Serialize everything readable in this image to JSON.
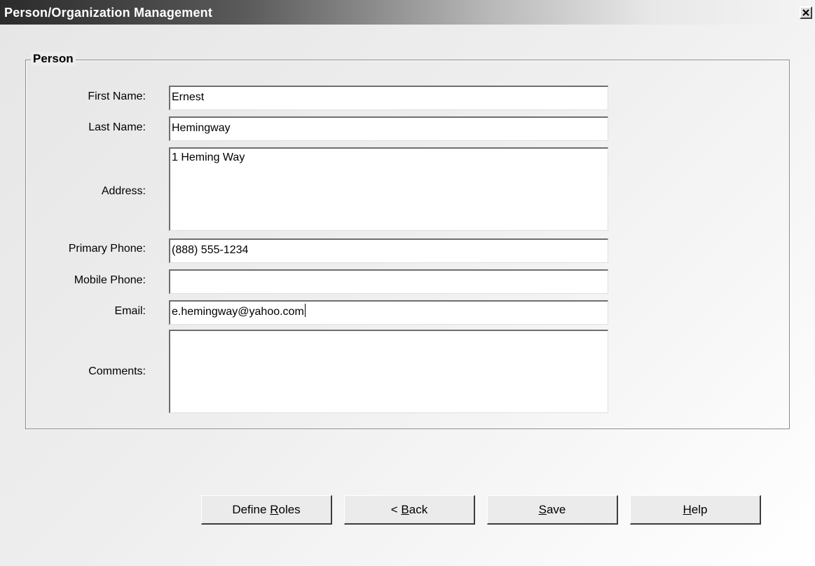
{
  "window": {
    "title": "Person/Organization Management",
    "close_icon": "close-icon"
  },
  "person_group": {
    "legend": "Person",
    "fields": {
      "first_name": {
        "label": "First Name:",
        "value": "Ernest"
      },
      "last_name": {
        "label": "Last Name:",
        "value": "Hemingway"
      },
      "address": {
        "label": "Address:",
        "value": "1 Heming Way"
      },
      "primary_phone": {
        "label": "Primary Phone:",
        "value": "(888) 555-1234"
      },
      "mobile_phone": {
        "label": "Mobile Phone:",
        "value": ""
      },
      "email": {
        "label": "Email:",
        "value": "e.hemingway@yahoo.com"
      },
      "comments": {
        "label": "Comments:",
        "value": ""
      }
    }
  },
  "buttons": {
    "define_roles": {
      "pre": "Define ",
      "mnemonic": "R",
      "post": "oles"
    },
    "back": {
      "pre": "< ",
      "mnemonic": "B",
      "post": "ack"
    },
    "save": {
      "pre": "",
      "mnemonic": "S",
      "post": "ave"
    },
    "help": {
      "pre": "",
      "mnemonic": "H",
      "post": "elp"
    }
  }
}
